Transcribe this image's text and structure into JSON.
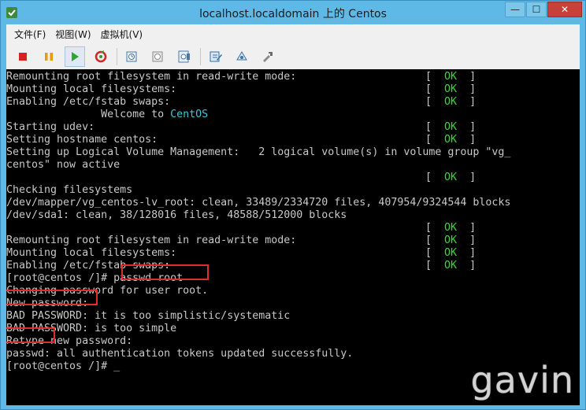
{
  "window": {
    "title": "localhost.localdomain 上的 Centos"
  },
  "window_buttons": {
    "minimize": "—",
    "maximize": "☐",
    "close": "✕"
  },
  "menu": [
    {
      "label": "文件(F)"
    },
    {
      "label": "视图(W)"
    },
    {
      "label": "虚拟机(V)"
    }
  ],
  "toolbar_icons": [
    "stop-icon",
    "pause-icon",
    "play-icon",
    "reset-icon",
    "snapshot-icon",
    "snapshot-revert-icon",
    "snapshot-manager-icon",
    "edit-settings-icon",
    "network-icon",
    "tools-icon"
  ],
  "ok_label": {
    "left": "[",
    "word": "OK",
    "right": "]"
  },
  "terminal": {
    "lines": [
      {
        "text": "Remounting root filesystem in read-write mode:",
        "ok": true
      },
      {
        "text": "Mounting local filesystems:",
        "ok": true
      },
      {
        "text": "Enabling /etc/fstab swaps:",
        "ok": true
      },
      {
        "text_pre": "               Welcome to ",
        "text_highlight": "CentOS"
      },
      {
        "text": "Starting udev:",
        "ok": true
      },
      {
        "text": "Setting hostname centos:",
        "ok": true
      },
      {
        "text": "Setting up Logical Volume Management:   2 logical volume(s) in volume group \"vg_"
      },
      {
        "text": "centos\" now active"
      },
      {
        "text": "",
        "ok": true
      },
      {
        "text": "Checking filesystems"
      },
      {
        "text": "/dev/mapper/vg_centos-lv_root: clean, 33489/2334720 files, 407954/9324544 blocks"
      },
      {
        "text": "/dev/sda1: clean, 38/128016 files, 48588/512000 blocks"
      },
      {
        "text": "",
        "ok": true
      },
      {
        "text": "Remounting root filesystem in read-write mode:",
        "ok": true
      },
      {
        "text": "Mounting local filesystems:",
        "ok": true
      },
      {
        "text": "Enabling /etc/fstab swaps:",
        "ok": true
      },
      {
        "text": "[root@centos /]# passwd root"
      },
      {
        "text": "Changing password for user root."
      },
      {
        "text": "New password:"
      },
      {
        "text": "BAD PASSWORD: it is too simplistic/systematic"
      },
      {
        "text": "BAD PASSWORD: is too simple"
      },
      {
        "text": "Retype new password:"
      },
      {
        "text": "passwd: all authentication tokens updated successfully."
      },
      {
        "text": "[root@centos /]# _"
      }
    ]
  },
  "watermark": "gavin"
}
